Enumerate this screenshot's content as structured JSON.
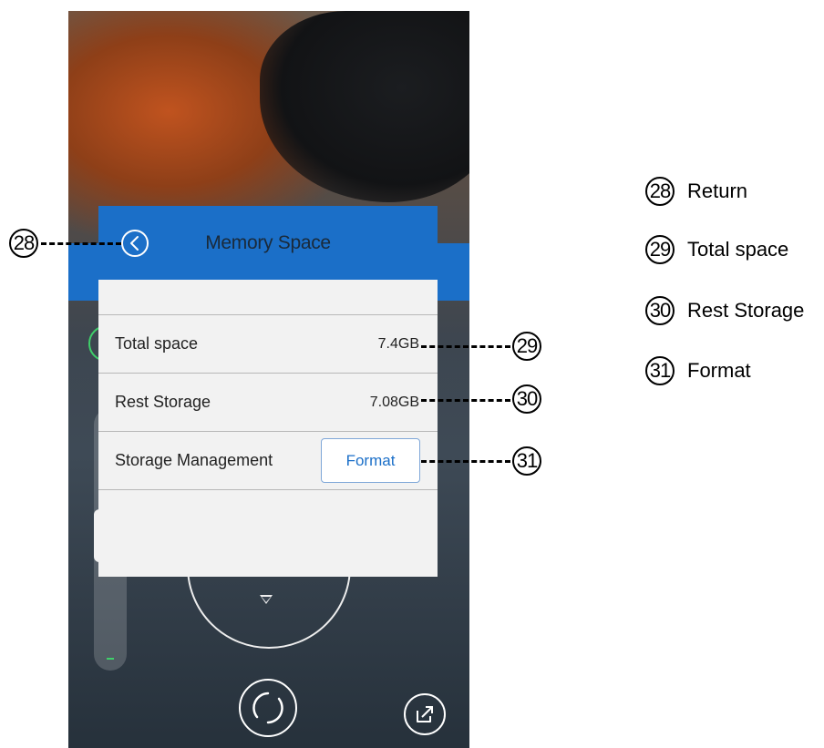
{
  "dialog": {
    "title": "Memory Space",
    "rows": [
      {
        "label": "Total space",
        "value": "7.4GB"
      },
      {
        "label": "Rest Storage",
        "value": "7.08GB"
      },
      {
        "label": "Storage Management",
        "button": "Format"
      }
    ]
  },
  "callouts": [
    {
      "number": "28",
      "label": "Return"
    },
    {
      "number": "29",
      "label": "Total space"
    },
    {
      "number": "30",
      "label": "Rest Storage"
    },
    {
      "number": "31",
      "label": "Format"
    }
  ],
  "colors": {
    "header_blue": "#1b6fc8",
    "dialog_bg": "#f2f2f2",
    "button_text": "#1b6fc8",
    "indicator_green": "#3fcf6a"
  },
  "icons": [
    "back-arrow-icon",
    "shutter-icon",
    "share-icon",
    "down-arrow-icon"
  ]
}
